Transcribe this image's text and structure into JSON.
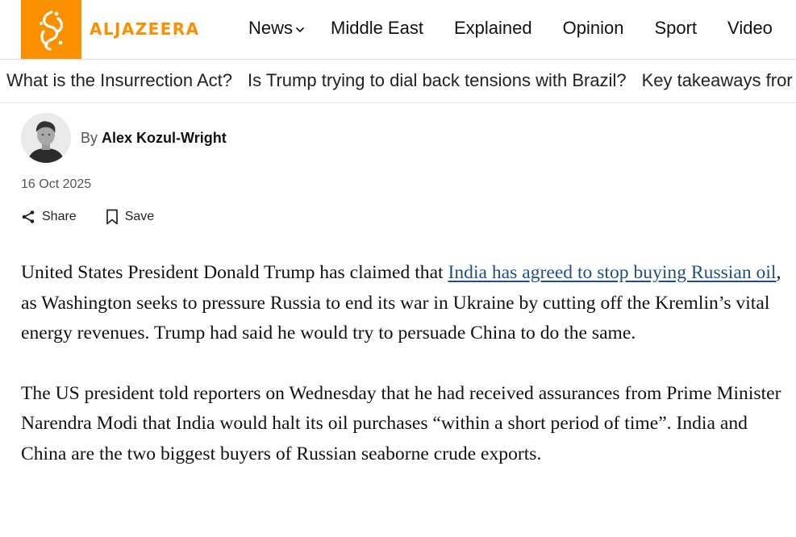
{
  "header": {
    "logo_text": "ALJAZEERA",
    "brand_color": "#fa9000",
    "nav": [
      {
        "label": "News"
      },
      {
        "label": "Middle East"
      },
      {
        "label": "Explained"
      },
      {
        "label": "Opinion"
      },
      {
        "label": "Sport"
      },
      {
        "label": "Video"
      }
    ]
  },
  "trending": [
    {
      "label": "What is the Insurrection Act?"
    },
    {
      "label": "Is Trump trying to dial back tensions with Brazil?"
    },
    {
      "label": "Key takeaways fror"
    }
  ],
  "byline": {
    "prefix": "By",
    "author": "Alex Kozul-Wright",
    "date": "16 Oct 2025"
  },
  "actions": {
    "share_label": "Share",
    "save_label": "Save"
  },
  "article": {
    "p1_before": "United States President Donald Trump has claimed that ",
    "p1_link": "India has agreed to stop buy­ing Russian oil",
    "p1_after": ", as Washington seeks to pressure Russia to end its war in Ukraine by cutting off the Kremlin’s vital energy revenues. Trump had said he would try to per­suade China to do the same.",
    "p2": "The US president told reporters on Wednesday that he had received assurances from Prime Minister Narendra Modi that India would halt its oil purchases “within a short period of time”. India and China are the two biggest buyers of Russian seaborne crude exports.",
    "link_color": "#1f4f86"
  }
}
